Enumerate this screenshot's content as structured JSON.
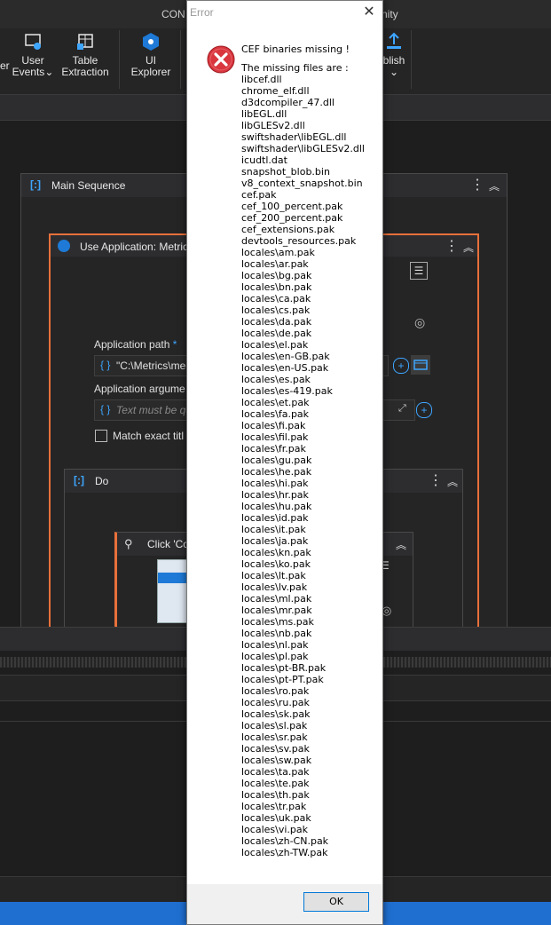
{
  "window": {
    "title_left": "CON",
    "title_right": "nity"
  },
  "ribbon": {
    "partial_left": "er",
    "user_events": {
      "line1": "User",
      "line2": "Events",
      "chevron": "⌄"
    },
    "table_extraction": {
      "line1": "Table",
      "line2": "Extraction"
    },
    "ui_explorer": {
      "line1": "UI",
      "line2": "Explorer"
    },
    "publish_partial": "blish",
    "publish_chevron": "⌄"
  },
  "workflow": {
    "main_sequence": "Main Sequence",
    "use_application": "Use Application: Metric",
    "application_path_label": "Application path",
    "required_star": "*",
    "application_path_value": "\"C:\\Metrics\\me",
    "application_arguments_label": "Application argume",
    "application_arguments_placeholder": "Text must be qu",
    "match_exact_title": "Match exact titl",
    "do_label": "Do",
    "click_label": "Click 'Co"
  },
  "dialog": {
    "title": "Error",
    "close_glyph": "✕",
    "heading": "CEF binaries missing !",
    "subheading": "The missing files are :",
    "files": [
      "libcef.dll",
      "chrome_elf.dll",
      "d3dcompiler_47.dll",
      "libEGL.dll",
      "libGLESv2.dll",
      "swiftshader\\libEGL.dll",
      "swiftshader\\libGLESv2.dll",
      "icudtl.dat",
      "snapshot_blob.bin",
      "v8_context_snapshot.bin",
      "cef.pak",
      "cef_100_percent.pak",
      "cef_200_percent.pak",
      "cef_extensions.pak",
      "devtools_resources.pak",
      "locales\\am.pak",
      "locales\\ar.pak",
      "locales\\bg.pak",
      "locales\\bn.pak",
      "locales\\ca.pak",
      "locales\\cs.pak",
      "locales\\da.pak",
      "locales\\de.pak",
      "locales\\el.pak",
      "locales\\en-GB.pak",
      "locales\\en-US.pak",
      "locales\\es.pak",
      "locales\\es-419.pak",
      "locales\\et.pak",
      "locales\\fa.pak",
      "locales\\fi.pak",
      "locales\\fil.pak",
      "locales\\fr.pak",
      "locales\\gu.pak",
      "locales\\he.pak",
      "locales\\hi.pak",
      "locales\\hr.pak",
      "locales\\hu.pak",
      "locales\\id.pak",
      "locales\\it.pak",
      "locales\\ja.pak",
      "locales\\kn.pak",
      "locales\\ko.pak",
      "locales\\lt.pak",
      "locales\\lv.pak",
      "locales\\ml.pak",
      "locales\\mr.pak",
      "locales\\ms.pak",
      "locales\\nb.pak",
      "locales\\nl.pak",
      "locales\\pl.pak",
      "locales\\pt-BR.pak",
      "locales\\pt-PT.pak",
      "locales\\ro.pak",
      "locales\\ru.pak",
      "locales\\sk.pak",
      "locales\\sl.pak",
      "locales\\sr.pak",
      "locales\\sv.pak",
      "locales\\sw.pak",
      "locales\\ta.pak",
      "locales\\te.pak",
      "locales\\th.pak",
      "locales\\tr.pak",
      "locales\\uk.pak",
      "locales\\vi.pak",
      "locales\\zh-CN.pak",
      "locales\\zh-TW.pak"
    ],
    "ok_label": "OK",
    "icon": "error-icon"
  },
  "colors": {
    "accent_blue": "#1f6fd1",
    "use_app_border": "#e8703a",
    "error_red": "#d9363e"
  }
}
